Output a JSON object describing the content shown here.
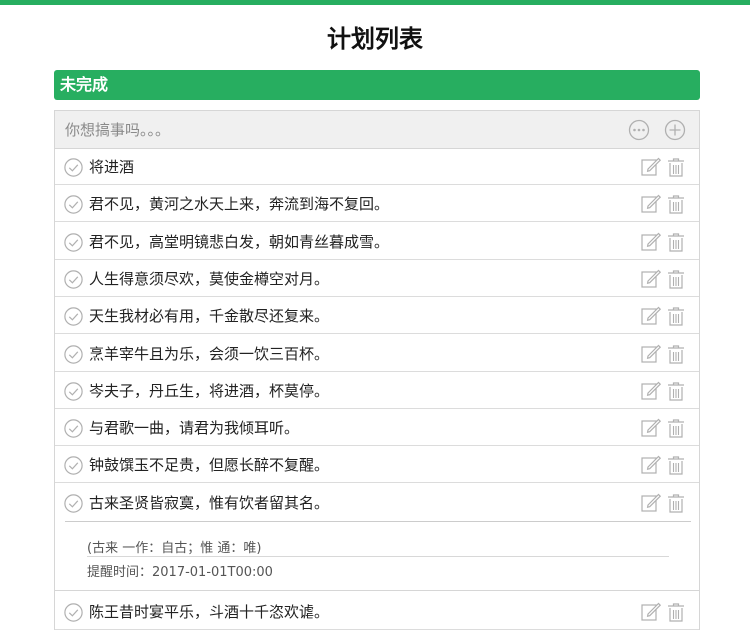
{
  "page": {
    "title": "计划列表"
  },
  "section": {
    "label": "未完成"
  },
  "input": {
    "placeholder": "你想搞事吗。。。"
  },
  "icons": {
    "comment": "comment-icon",
    "add": "plus-circle-icon",
    "check": "check-circle-icon",
    "edit": "edit-icon",
    "delete": "trash-icon"
  },
  "colors": {
    "accent": "#27ae60",
    "icon_gray": "#b0b0b0"
  },
  "todos": [
    "将进酒",
    "君不见，黄河之水天上来，奔流到海不复回。",
    "君不见，高堂明镜悲白发，朝如青丝暮成雪。",
    "人生得意须尽欢，莫使金樽空对月。",
    "天生我材必有用，千金散尽还复来。",
    "烹羊宰牛且为乐，会须一饮三百杯。",
    "岑夫子，丹丘生，将进酒，杯莫停。",
    "与君歌一曲，请君为我倾耳听。",
    "钟鼓馔玉不足贵，但愿长醉不复醒。",
    "古来圣贤皆寂寞，惟有饮者留其名。",
    "陈王昔时宴平乐，斗酒十千恣欢谑。"
  ],
  "expanded": {
    "note": "(古来 一作：自古；惟 通：唯)",
    "reminder": "提醒时间：2017-01-01T00:00"
  }
}
